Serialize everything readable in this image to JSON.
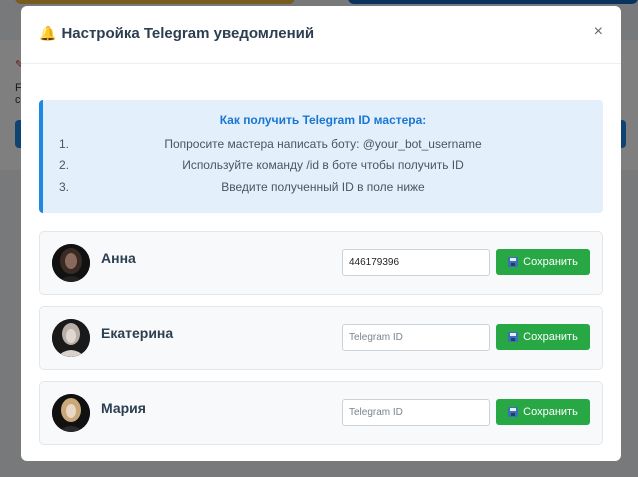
{
  "background": {
    "mark": "✎",
    "letters": [
      "F",
      "c"
    ]
  },
  "modal": {
    "icon": "bell-icon",
    "title": "Настройка Telegram уведомлений",
    "close_label": "×"
  },
  "info": {
    "title": "Как получить Telegram ID мастера:",
    "steps": [
      {
        "num": "1.",
        "text": "Попросите мастера написать боту: @your_bot_username"
      },
      {
        "num": "2.",
        "text": "Используйте команду /id в боте чтобы получить ID"
      },
      {
        "num": "3.",
        "text": "Введите полученный ID в поле ниже"
      }
    ]
  },
  "masters": [
    {
      "name": "Анна",
      "telegram_id": "446179396",
      "placeholder": "Telegram ID",
      "save_label": "Сохранить",
      "save_icon": "floppy-disk-icon"
    },
    {
      "name": "Екатерина",
      "telegram_id": "",
      "placeholder": "Telegram ID",
      "save_label": "Сохранить",
      "save_icon": "floppy-disk-icon"
    },
    {
      "name": "Мария",
      "telegram_id": "",
      "placeholder": "Telegram ID",
      "save_label": "Сохранить",
      "save_icon": "floppy-disk-icon"
    }
  ],
  "colors": {
    "accent": "#1e88e5",
    "success": "#28a745",
    "info_bg": "#e3f0fc"
  }
}
